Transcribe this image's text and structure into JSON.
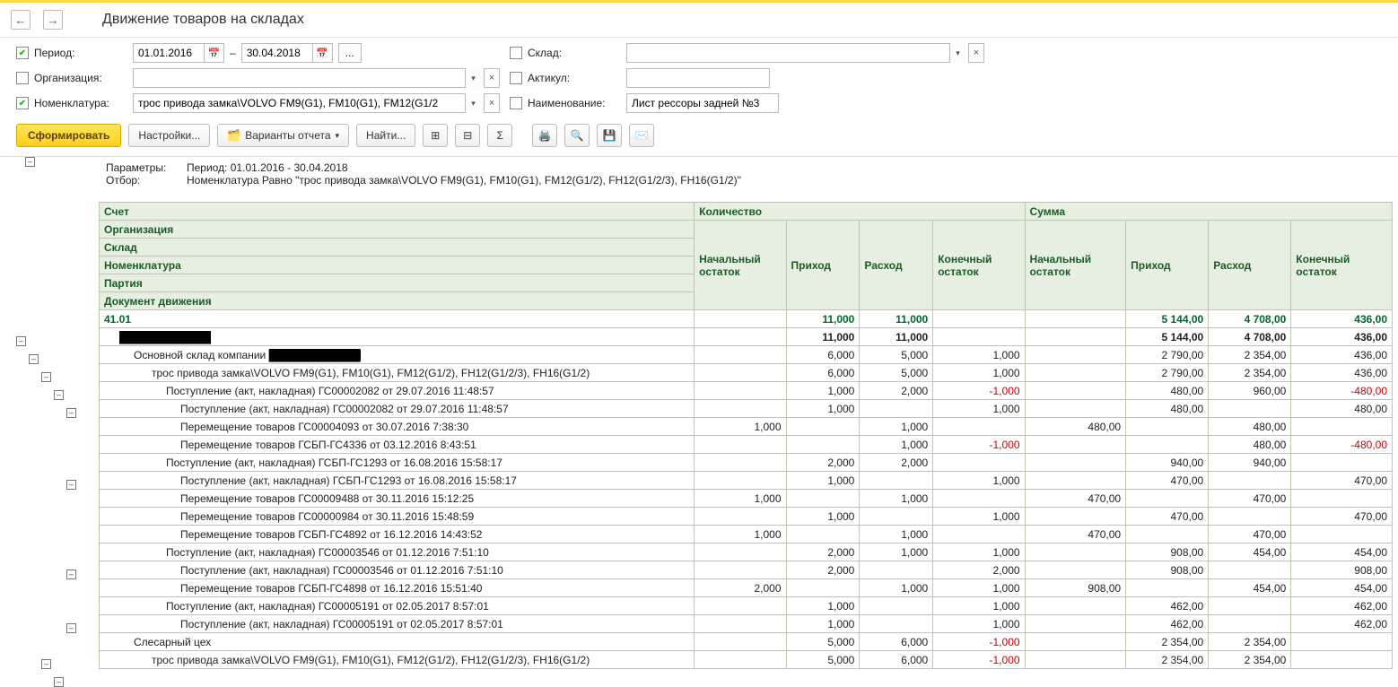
{
  "title": "Движение товаров на складах",
  "filters": {
    "period_label": "Период:",
    "date_from": "01.01.2016",
    "date_to": "30.04.2018",
    "org_label": "Организация:",
    "org_value": "",
    "nomen_label": "Номенклатура:",
    "nomen_value": "трос привода замка\\VOLVO FM9(G1), FM10(G1), FM12(G1/2",
    "sklad_label": "Склад:",
    "sklad_value": "",
    "artikul_label": "Актикул:",
    "artikul_value": "",
    "name_label": "Наименование:",
    "name_value": "Лист рессоры задней №3"
  },
  "toolbar": {
    "generate": "Сформировать",
    "settings": "Настройки...",
    "variants": "Варианты отчета",
    "find": "Найти..."
  },
  "params": {
    "l1": "Параметры:",
    "v1": "Период: 01.01.2016 - 30.04.2018",
    "l2": "Отбор:",
    "v2": "Номенклатура Равно \"трос привода замка\\VOLVO FM9(G1), FM10(G1), FM12(G1/2), FH12(G1/2/3), FH16(G1/2)\""
  },
  "headers": {
    "left": [
      "Счет",
      "Организация",
      "Склад",
      "Номенклатура",
      "Партия",
      "Документ движения"
    ],
    "qty_group": "Количество",
    "sum_group": "Сумма",
    "start": "Начальный остаток",
    "in": "Приход",
    "out": "Расход",
    "end": "Конечный остаток"
  },
  "rows": [
    {
      "lvl": 0,
      "name": "41.01",
      "q_in": "11,000",
      "q_out": "11,000",
      "s_in": "5 144,00",
      "s_out": "4 708,00",
      "s_end": "436,00"
    },
    {
      "lvl": 1,
      "name": "[redacted-org]",
      "q_in": "11,000",
      "q_out": "11,000",
      "s_in": "5 144,00",
      "s_out": "4 708,00",
      "s_end": "436,00"
    },
    {
      "lvl": 2,
      "name": "Основной склад компании [redacted]",
      "q_in": "6,000",
      "q_out": "5,000",
      "q_end": "1,000",
      "s_in": "2 790,00",
      "s_out": "2 354,00",
      "s_end": "436,00"
    },
    {
      "lvl": 3,
      "name": "трос привода замка\\VOLVO FM9(G1), FM10(G1), FM12(G1/2), FH12(G1/2/3), FH16(G1/2)",
      "q_in": "6,000",
      "q_out": "5,000",
      "q_end": "1,000",
      "s_in": "2 790,00",
      "s_out": "2 354,00",
      "s_end": "436,00"
    },
    {
      "lvl": 4,
      "name": "Поступление (акт, накладная) ГС00002082 от 29.07.2016 11:48:57",
      "q_in": "1,000",
      "q_out": "2,000",
      "q_end": "-1,000",
      "neg_qend": true,
      "s_in": "480,00",
      "s_out": "960,00",
      "s_end": "-480,00",
      "neg_send": true
    },
    {
      "lvl": 5,
      "name": "Поступление (акт, накладная) ГС00002082 от 29.07.2016 11:48:57",
      "q_in": "1,000",
      "q_end": "1,000",
      "s_in": "480,00",
      "s_end": "480,00"
    },
    {
      "lvl": 5,
      "name": "Перемещение товаров ГС00004093 от 30.07.2016 7:38:30",
      "q_start": "1,000",
      "q_out": "1,000",
      "s_start": "480,00",
      "s_out": "480,00"
    },
    {
      "lvl": 5,
      "name": "Перемещение товаров ГСБП-ГС4336 от 03.12.2016 8:43:51",
      "q_out": "1,000",
      "q_end": "-1,000",
      "neg_qend": true,
      "s_out": "480,00",
      "s_end": "-480,00",
      "neg_send": true
    },
    {
      "lvl": 4,
      "name": "Поступление (акт, накладная) ГСБП-ГС1293 от 16.08.2016 15:58:17",
      "q_in": "2,000",
      "q_out": "2,000",
      "s_in": "940,00",
      "s_out": "940,00"
    },
    {
      "lvl": 5,
      "name": "Поступление (акт, накладная) ГСБП-ГС1293 от 16.08.2016 15:58:17",
      "q_in": "1,000",
      "q_end": "1,000",
      "s_in": "470,00",
      "s_end": "470,00"
    },
    {
      "lvl": 5,
      "name": "Перемещение товаров ГС00009488 от 30.11.2016 15:12:25",
      "q_start": "1,000",
      "q_out": "1,000",
      "s_start": "470,00",
      "s_out": "470,00"
    },
    {
      "lvl": 5,
      "name": "Перемещение товаров ГС00000984 от 30.11.2016 15:48:59",
      "q_in": "1,000",
      "q_end": "1,000",
      "s_in": "470,00",
      "s_end": "470,00"
    },
    {
      "lvl": 5,
      "name": "Перемещение товаров ГСБП-ГС4892 от 16.12.2016 14:43:52",
      "q_start": "1,000",
      "q_out": "1,000",
      "s_start": "470,00",
      "s_out": "470,00"
    },
    {
      "lvl": 4,
      "name": "Поступление (акт, накладная) ГС00003546 от 01.12.2016 7:51:10",
      "q_in": "2,000",
      "q_out": "1,000",
      "q_end": "1,000",
      "s_in": "908,00",
      "s_out": "454,00",
      "s_end": "454,00"
    },
    {
      "lvl": 5,
      "name": "Поступление (акт, накладная) ГС00003546 от 01.12.2016 7:51:10",
      "q_in": "2,000",
      "q_end": "2,000",
      "s_in": "908,00",
      "s_end": "908,00"
    },
    {
      "lvl": 5,
      "name": "Перемещение товаров ГСБП-ГС4898 от 16.12.2016 15:51:40",
      "q_start": "2,000",
      "q_out": "1,000",
      "q_end": "1,000",
      "s_start": "908,00",
      "s_out": "454,00",
      "s_end": "454,00"
    },
    {
      "lvl": 4,
      "name": "Поступление (акт, накладная) ГС00005191 от 02.05.2017 8:57:01",
      "q_in": "1,000",
      "q_end": "1,000",
      "s_in": "462,00",
      "s_end": "462,00"
    },
    {
      "lvl": 5,
      "name": "Поступление (акт, накладная) ГС00005191 от 02.05.2017 8:57:01",
      "q_in": "1,000",
      "q_end": "1,000",
      "s_in": "462,00",
      "s_end": "462,00"
    },
    {
      "lvl": 2,
      "name": "Слесарный цех",
      "q_in": "5,000",
      "q_out": "6,000",
      "q_end": "-1,000",
      "neg_qend": true,
      "s_in": "2 354,00",
      "s_out": "2 354,00"
    },
    {
      "lvl": 3,
      "name": "трос привода замка\\VOLVO FM9(G1), FM10(G1), FM12(G1/2), FH12(G1/2/3), FH16(G1/2)",
      "q_in": "5,000",
      "q_out": "6,000",
      "q_end": "-1,000",
      "neg_qend": true,
      "s_in": "2 354,00",
      "s_out": "2 354,00"
    }
  ]
}
